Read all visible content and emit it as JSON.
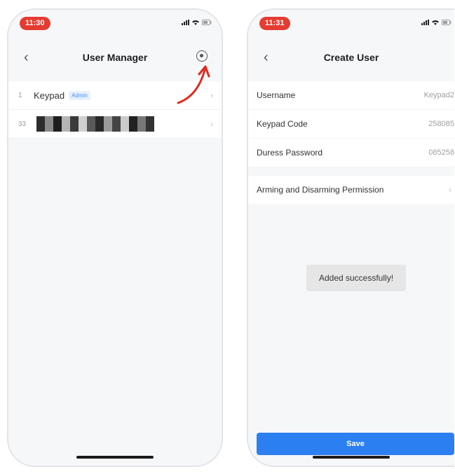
{
  "left_screen": {
    "status": {
      "time": "11:30"
    },
    "nav": {
      "title": "User Manager",
      "back_icon": "chevron-left-icon",
      "add_icon": "add-circle-icon"
    },
    "users": [
      {
        "index": "1",
        "name": "Keypad",
        "badge": "Admin"
      },
      {
        "index": "33",
        "name": ""
      }
    ]
  },
  "right_screen": {
    "status": {
      "time": "11:31"
    },
    "nav": {
      "title": "Create User",
      "back_icon": "chevron-left-icon"
    },
    "fields": [
      {
        "label": "Username",
        "value": "Keypad2"
      },
      {
        "label": "Keypad Code",
        "value": "258085"
      },
      {
        "label": "Duress Password",
        "value": "085258"
      }
    ],
    "permission": {
      "label": "Arming and Disarming Permission"
    },
    "toast": "Added successfully!",
    "save_label": "Save"
  },
  "colors": {
    "status_pill": "#e63b30",
    "primary": "#2b7ff0",
    "annotation_arrow": "#e02a1e"
  }
}
